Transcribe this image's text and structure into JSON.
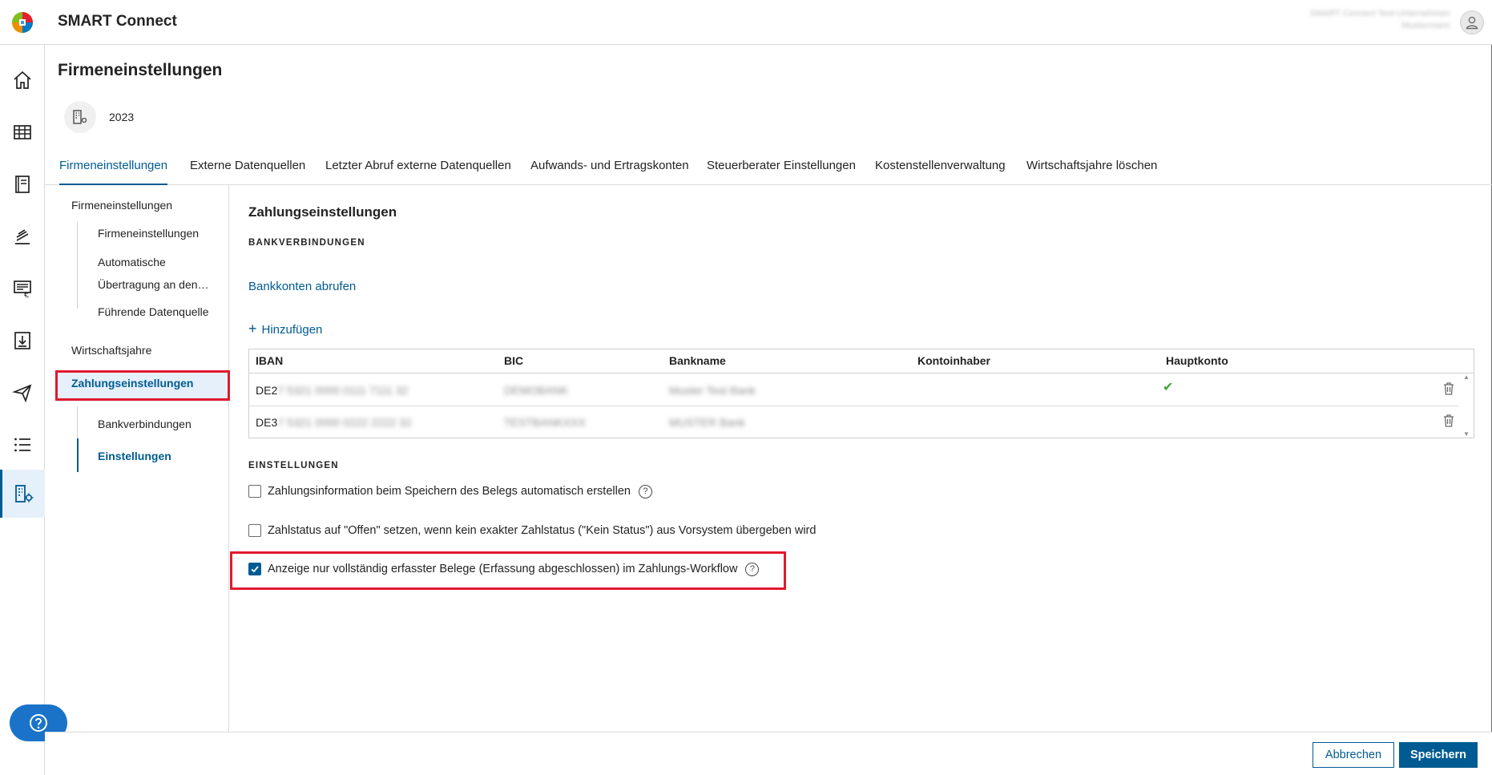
{
  "app": {
    "title": "SMART Connect",
    "user_line1": "SMART Connect Test-Unternehmen",
    "user_line2": "Mustermann"
  },
  "rail": {
    "items": [
      {
        "icon": "home-icon"
      },
      {
        "icon": "table-icon"
      },
      {
        "icon": "book-icon"
      },
      {
        "icon": "bookings-icon"
      },
      {
        "icon": "invoice-icon"
      },
      {
        "icon": "import-icon"
      },
      {
        "icon": "send-icon"
      },
      {
        "icon": "list-icon"
      },
      {
        "icon": "company-settings-icon"
      }
    ],
    "active_index": 8
  },
  "page": {
    "title": "Firmeneinstellungen",
    "company_year": "2023"
  },
  "tabs": [
    {
      "label": "Firmeneinstellungen",
      "active": true
    },
    {
      "label": "Externe Datenquellen"
    },
    {
      "label": "Letzter Abruf externe Datenquellen"
    },
    {
      "label": "Aufwands- und Ertragskonten"
    },
    {
      "label": "Steuerberater Einstellungen"
    },
    {
      "label": "Kostenstellenverwaltung"
    },
    {
      "label": "Wirtschaftsjahre löschen"
    }
  ],
  "secnav": {
    "group1": "Firmeneinstellungen",
    "group1_items": [
      "Firmeneinstellungen",
      "Automatische",
      "Übertragung an den…",
      "Führende Datenquelle"
    ],
    "group2": "Wirtschaftsjahre",
    "group3": "Zahlungseinstellungen",
    "group3_items": [
      "Bankverbindungen",
      "Einstellungen"
    ]
  },
  "content": {
    "section_title": "Zahlungseinstellungen",
    "bank_overline": "BANKVERBINDUNGEN",
    "fetch_link": "Bankkonten abrufen",
    "add_link": "Hinzufügen",
    "table": {
      "columns": [
        "IBAN",
        "BIC",
        "Bankname",
        "Kontoinhaber",
        "Hauptkonto"
      ],
      "rows": [
        {
          "iban_prefix": "DE2",
          "iban_rest": "7 5321 0000 0111 7111 32",
          "bic": "DEMOBANK",
          "bank": "Muster Test Bank",
          "holder": "",
          "main": true
        },
        {
          "iban_prefix": "DE3",
          "iban_rest": "7 5321 0000 0222 2222 32",
          "bic": "TESTBANKXXX",
          "bank": "MUSTER Bank",
          "holder": "",
          "main": false
        }
      ]
    },
    "settings_overline": "EINSTELLUNGEN",
    "options": [
      {
        "label": "Zahlungsinformation beim Speichern des Belegs automatisch erstellen",
        "checked": false,
        "help": true
      },
      {
        "label": "Zahlstatus auf \"Offen\" setzen, wenn kein exakter Zahlstatus (\"Kein Status\") aus Vorsystem übergeben wird",
        "checked": false,
        "help": false
      },
      {
        "label": "Anzeige nur vollständig erfasster Belege (Erfassung abgeschlossen) im Zahlungs-Workflow",
        "checked": true,
        "help": true
      }
    ]
  },
  "footer": {
    "cancel": "Abbrechen",
    "save": "Speichern"
  },
  "colors": {
    "accent": "#005b92",
    "highlight": "#e01a2f",
    "check": "#47a23f"
  }
}
